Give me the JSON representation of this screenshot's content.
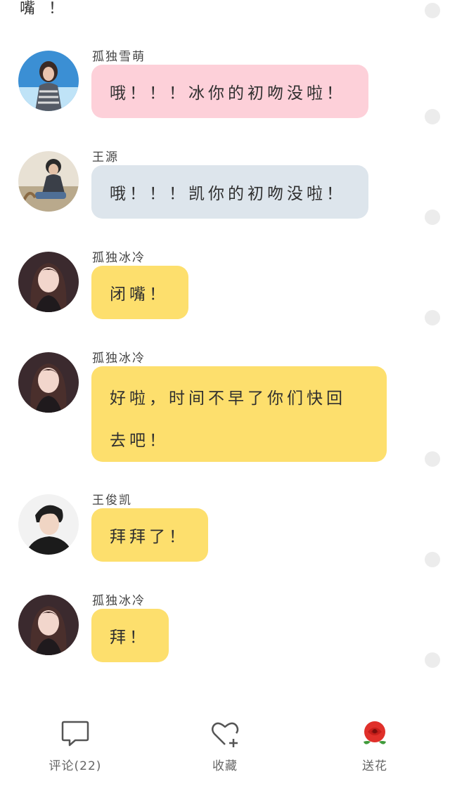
{
  "top_fragment_text": "嘴 ！",
  "messages": [
    {
      "sender": "孤独雪萌",
      "text": "哦！！！冰你的初吻没啦！",
      "bubble_color": "#fdd0d9",
      "avatar": "avatar-beach-girl"
    },
    {
      "sender": "王源",
      "text": "哦！！！凯你的初吻没啦！",
      "bubble_color": "#dde5ec",
      "avatar": "avatar-boy-sitting"
    },
    {
      "sender": "孤独冰冷",
      "text": "闭嘴！",
      "bubble_color": "#fddf6d",
      "avatar": "avatar-long-hair-girl"
    },
    {
      "sender": "孤独冰冷",
      "text_line1": "好啦，时间不早了你们快回",
      "text_line2": "去吧！",
      "bubble_color": "#fddf6d",
      "avatar": "avatar-long-hair-girl"
    },
    {
      "sender": "王俊凯",
      "text": "拜拜了！",
      "bubble_color": "#fddf6d",
      "avatar": "avatar-boy-black-shirt"
    },
    {
      "sender": "孤独冰冷",
      "text": "拜！",
      "bubble_color": "#fddf6d",
      "avatar": "avatar-long-hair-girl"
    }
  ],
  "bottom_bar": {
    "comment_label": "评论(22)",
    "favorite_label": "收藏",
    "flower_label": "送花",
    "comment_icon": "speech-bubble-icon",
    "favorite_icon": "heart-plus-icon",
    "flower_icon": "rose-icon"
  },
  "colors": {
    "pink_bubble": "#fdd0d9",
    "blue_bubble": "#dde5ec",
    "yellow_bubble": "#fddf6d",
    "timeline_dot": "#ececec"
  }
}
